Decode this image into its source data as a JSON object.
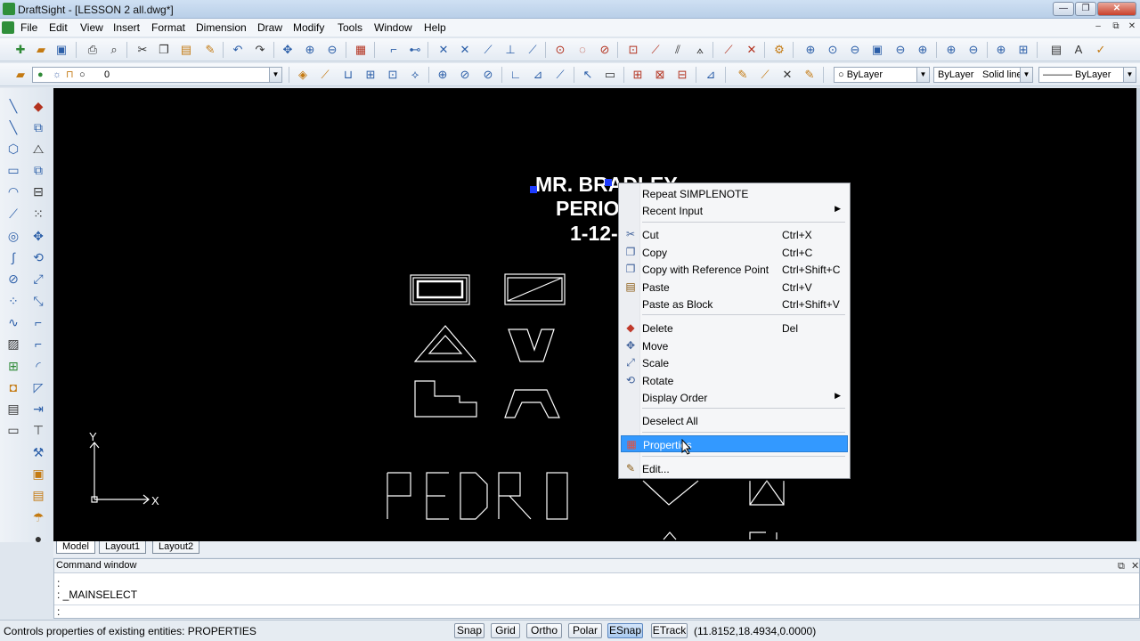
{
  "window": {
    "title": "DraftSight - [LESSON 2 all.dwg*]",
    "controls": {
      "minimize": "—",
      "restore": "❐",
      "close": "✕"
    }
  },
  "menu": [
    "File",
    "Edit",
    "View",
    "Insert",
    "Format",
    "Dimension",
    "Draw",
    "Modify",
    "Tools",
    "Window",
    "Help"
  ],
  "mdi_controls": {
    "minimize": "–",
    "restore": "⧉",
    "close": "✕"
  },
  "layer_combo": {
    "value": "0"
  },
  "properties_bar": {
    "color": "ByLayer",
    "line_style_layer": "ByLayer",
    "line_style": "Solid line",
    "line_weight": "——— ByLayer"
  },
  "drawing": {
    "note_lines": [
      "MR. BRADLEY",
      "PERIOD",
      "1-12-"
    ],
    "name_text": "PEDRO",
    "ucs": {
      "y": "Y",
      "x": "X"
    }
  },
  "context_menu": {
    "items": [
      {
        "label": "Repeat SIMPLENOTE",
        "shortcut": "",
        "submenu": false,
        "icon": ""
      },
      {
        "label": "Recent Input",
        "shortcut": "",
        "submenu": true,
        "icon": ""
      },
      {
        "label": "Cut",
        "shortcut": "Ctrl+X",
        "submenu": false,
        "icon": "scissors-icon"
      },
      {
        "label": "Copy",
        "shortcut": "Ctrl+C",
        "submenu": false,
        "icon": "copy-icon"
      },
      {
        "label": "Copy with Reference Point",
        "shortcut": "Ctrl+Shift+C",
        "submenu": false,
        "icon": "copy-ref-icon"
      },
      {
        "label": "Paste",
        "shortcut": "Ctrl+V",
        "submenu": false,
        "icon": "paste-icon"
      },
      {
        "label": "Paste as Block",
        "shortcut": "Ctrl+Shift+V",
        "submenu": false,
        "icon": ""
      },
      {
        "label": "Delete",
        "shortcut": "Del",
        "submenu": false,
        "icon": "eraser-icon"
      },
      {
        "label": "Move",
        "shortcut": "",
        "submenu": false,
        "icon": "move-icon"
      },
      {
        "label": "Scale",
        "shortcut": "",
        "submenu": false,
        "icon": "scale-icon"
      },
      {
        "label": "Rotate",
        "shortcut": "",
        "submenu": false,
        "icon": "rotate-icon"
      },
      {
        "label": "Display Order",
        "shortcut": "",
        "submenu": true,
        "icon": ""
      },
      {
        "label": "Deselect All",
        "shortcut": "",
        "submenu": false,
        "icon": ""
      },
      {
        "label": "Properties",
        "shortcut": "",
        "submenu": false,
        "icon": "properties-icon",
        "highlighted": true
      },
      {
        "label": "Edit...",
        "shortcut": "",
        "submenu": false,
        "icon": "edit-icon"
      }
    ]
  },
  "tabs": [
    "Model",
    "Layout1",
    "Layout2"
  ],
  "active_tab": "Model",
  "command_window": {
    "title": "Command window",
    "controls": {
      "float": "⧉",
      "close": "✕"
    },
    "history": [
      ":",
      ": _MAINSELECT"
    ],
    "prompt": ":"
  },
  "status": {
    "message": "Controls properties of existing entities:  PROPERTIES",
    "toggles": [
      {
        "label": "Snap",
        "on": false
      },
      {
        "label": "Grid",
        "on": false
      },
      {
        "label": "Ortho",
        "on": false
      },
      {
        "label": "Polar",
        "on": false
      },
      {
        "label": "ESnap",
        "on": true
      },
      {
        "label": "ETrack",
        "on": false
      }
    ],
    "coordinates": "(11.8152,18.4934,0.0000)"
  },
  "colors": {
    "canvas": "#000000",
    "highlight": "#3399ff",
    "grip": "#1e3cff"
  }
}
